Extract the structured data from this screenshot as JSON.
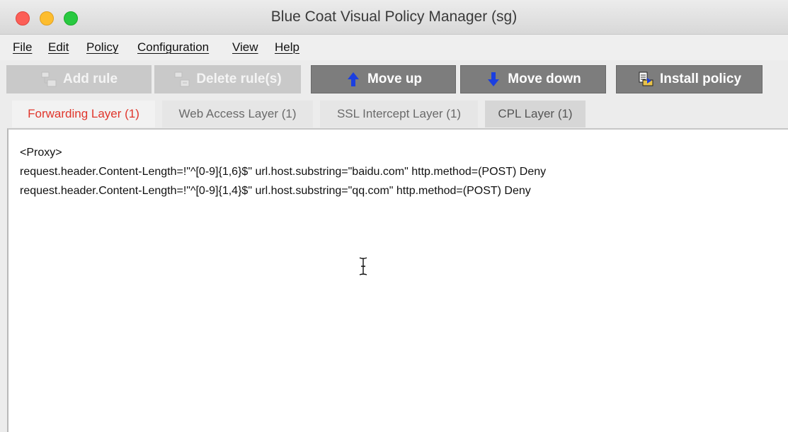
{
  "window": {
    "title": "Blue Coat Visual Policy Manager (sg)"
  },
  "menu": [
    {
      "label": "File"
    },
    {
      "label": "Edit"
    },
    {
      "label": "Policy"
    },
    {
      "label": "Configuration"
    },
    {
      "label": "View"
    },
    {
      "label": "Help"
    }
  ],
  "toolbar": {
    "add_rule": {
      "label": "Add rule",
      "enabled": false,
      "icon": "add-rule-icon"
    },
    "delete_rule": {
      "label": "Delete rule(s)",
      "enabled": false,
      "icon": "delete-rule-icon"
    },
    "move_up": {
      "label": "Move up",
      "enabled": true,
      "icon": "arrow-up-icon"
    },
    "move_down": {
      "label": "Move down",
      "enabled": true,
      "icon": "arrow-down-icon"
    },
    "install_policy": {
      "label": "Install policy",
      "enabled": true,
      "icon": "install-policy-icon"
    }
  },
  "tabs": [
    {
      "label": "Forwarding Layer (1)",
      "active": true
    },
    {
      "label": "Web Access Layer (1)",
      "active": false
    },
    {
      "label": "SSL Intercept Layer (1)",
      "active": false
    },
    {
      "label": "CPL Layer (1)",
      "active": false
    }
  ],
  "editor": {
    "lines": [
      "<Proxy>",
      "request.header.Content-Length=!\"^[0-9]{1,6}$\" url.host.substring=\"baidu.com\" http.method=(POST) Deny",
      "request.header.Content-Length=!\"^[0-9]{1,4}$\" url.host.substring=\"qq.com\" http.method=(POST) Deny"
    ]
  },
  "colors": {
    "active_tab_text": "#e0362c",
    "arrow_blue": "#1b3fe0",
    "button_enabled_bg": "#7d7d7d",
    "button_disabled_bg": "#c9c9c9"
  }
}
